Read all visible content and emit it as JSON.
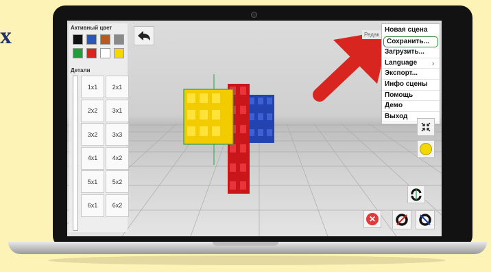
{
  "page": {
    "letter": "х"
  },
  "panel": {
    "active_color_label": "Активный цвет",
    "details_label": "Детали",
    "colors": [
      "#111111",
      "#2c56b8",
      "#b65a21",
      "#8a8a8a",
      "#1f9e3a",
      "#d8251f",
      "#ffffff",
      "#f3d800"
    ],
    "parts": [
      "1x1",
      "2x1",
      "2x2",
      "3x1",
      "3x2",
      "3x3",
      "4x1",
      "4x2",
      "5x1",
      "5x2",
      "6x1",
      "6x2"
    ]
  },
  "toolbar": {
    "back_icon": "back-arrow-icon"
  },
  "partial_label": "Редак",
  "menu": {
    "items": [
      {
        "label": "Новая сцена"
      },
      {
        "label": "Сохранить..."
      },
      {
        "label": "Загрузить..."
      },
      {
        "label": "Language"
      },
      {
        "label": "Экспорт..."
      },
      {
        "label": "Инфо сцены"
      },
      {
        "label": "Помощь"
      },
      {
        "label": "Демо"
      },
      {
        "label": "Выход"
      }
    ],
    "highlighted": "Сохранить..."
  },
  "colors": {
    "arrow": "#d8251f",
    "highlight": "#2e8b3d"
  }
}
